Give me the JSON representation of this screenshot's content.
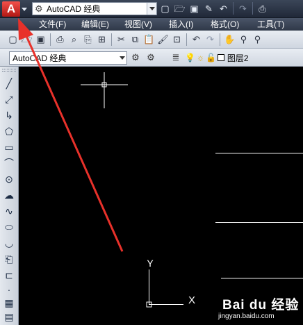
{
  "titlebar": {
    "app_logo_letter": "A",
    "workspace": "AutoCAD 经典",
    "quick_access_icons": [
      "new-icon",
      "open-icon",
      "save-icon",
      "save-as-icon",
      "undo-icon",
      "redo-icon",
      "print-icon"
    ]
  },
  "menubar": {
    "items": [
      "文件(F)",
      "编辑(E)",
      "视图(V)",
      "插入(I)",
      "格式(O)",
      "工具(T)"
    ]
  },
  "toolbar2": {
    "workspace": "AutoCAD 经典",
    "layer_name": "图层2"
  },
  "colors": {
    "canvas_bg": "#000000",
    "annotation_arrow": "#e8312a",
    "crosshair": "#ffffff"
  },
  "canvas": {
    "ucs_x_label": "X",
    "ucs_y_label": "Y"
  },
  "watermark": {
    "brand": "Bai du 经验",
    "url": "jingyan.baidu.com"
  }
}
